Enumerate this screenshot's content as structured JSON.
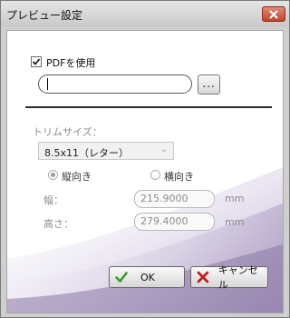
{
  "window": {
    "title": "プレビュー設定"
  },
  "pdf": {
    "checkbox_label": "PDFを使用",
    "checked": true,
    "path_value": ""
  },
  "browse": {
    "label": "..."
  },
  "trim": {
    "label": "トリムサイズ：",
    "selected": "8.5x11（レター）",
    "orientation": {
      "portrait": "縦向き",
      "landscape": "横向き",
      "selected": "portrait"
    }
  },
  "width": {
    "label": "幅：",
    "value": "215.9000",
    "unit": "mm"
  },
  "height": {
    "label": "高さ：",
    "value": "279.4000",
    "unit": "mm"
  },
  "buttons": {
    "ok": "OK",
    "cancel": "キャンセル"
  },
  "colors": {
    "ok_check": "#3a9a2a",
    "cancel_x": "#c4161c",
    "close_button": "#c0452f"
  },
  "icons": {
    "close": "close-icon",
    "ok": "check-icon",
    "cancel": "x-icon"
  }
}
